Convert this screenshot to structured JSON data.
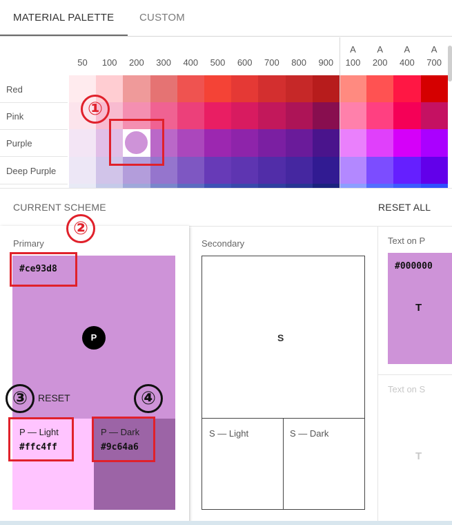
{
  "tabs": [
    {
      "label": "MATERIAL PALETTE",
      "active": true
    },
    {
      "label": "CUSTOM",
      "active": false
    }
  ],
  "palette": {
    "columns": [
      "50",
      "100",
      "200",
      "300",
      "400",
      "500",
      "600",
      "700",
      "800",
      "900"
    ],
    "accent_columns": [
      {
        "prefix": "A",
        "shade": "100"
      },
      {
        "prefix": "A",
        "shade": "200"
      },
      {
        "prefix": "A",
        "shade": "400"
      },
      {
        "prefix": "A",
        "shade": "700"
      }
    ],
    "rows": [
      {
        "name": "Red",
        "colors": [
          "#ffebee",
          "#ffcdd2",
          "#ef9a9a",
          "#e57373",
          "#ef5350",
          "#f44336",
          "#e53935",
          "#d32f2f",
          "#c62828",
          "#b71c1c"
        ],
        "accents": [
          "#ff8a80",
          "#ff5252",
          "#ff1744",
          "#d50000"
        ]
      },
      {
        "name": "Pink",
        "colors": [
          "#fce4ec",
          "#f8bbd0",
          "#f48fb1",
          "#f06292",
          "#ec407a",
          "#e91e63",
          "#d81b60",
          "#c2185b",
          "#ad1457",
          "#880e4f"
        ],
        "accents": [
          "#ff80ab",
          "#ff4081",
          "#f50057",
          "#c51162"
        ]
      },
      {
        "name": "Purple",
        "colors": [
          "#f3e5f5",
          "#e1bee7",
          "#ce93d8",
          "#ba68c8",
          "#ab47bc",
          "#9c27b0",
          "#8e24aa",
          "#7b1fa2",
          "#6a1b9a",
          "#4a148c"
        ],
        "accents": [
          "#ea80fc",
          "#e040fb",
          "#d500f9",
          "#aa00ff"
        ]
      },
      {
        "name": "Deep Purple",
        "colors": [
          "#ede7f6",
          "#d1c4e9",
          "#b39ddb",
          "#9575cd",
          "#7e57c2",
          "#673ab7",
          "#5e35b1",
          "#512da8",
          "#4527a0",
          "#311b92"
        ],
        "accents": [
          "#b388ff",
          "#7c4dff",
          "#651fff",
          "#6200ea"
        ]
      },
      {
        "name": "",
        "colors": [
          "#e8eaf6",
          "#c5cae9",
          "#9fa8da",
          "#7986cb",
          "#5c6bc0",
          "#3f51b5",
          "#3949ab",
          "#303f9f",
          "#283593",
          "#1a237e"
        ],
        "accents": [
          "#8c9eff",
          "#536dfe",
          "#3d5afe",
          "#304ffe"
        ]
      }
    ],
    "selected": {
      "row": "Purple",
      "shade": "200",
      "color": "#ce93d8"
    }
  },
  "scheme": {
    "title": "CURRENT SCHEME",
    "reset_all": "RESET ALL",
    "primary": {
      "label": "Primary",
      "hex": "#ce93d8",
      "color": "#ce93d8",
      "badge": "P",
      "reset": "RESET",
      "light": {
        "label": "P — Light",
        "hex": "#ffc4ff",
        "color": "#ffc4ff"
      },
      "dark": {
        "label": "P — Dark",
        "hex": "#9c64a6",
        "color": "#9c64a6"
      }
    },
    "secondary": {
      "label": "Secondary",
      "letter": "S",
      "light": {
        "label": "S — Light"
      },
      "dark": {
        "label": "S — Dark"
      }
    },
    "text_on_p": {
      "label": "Text on P",
      "hex": "#000000",
      "letter": "T",
      "bg": "#ce93d8"
    },
    "text_on_s": {
      "label": "Text on S",
      "letter": "T"
    }
  },
  "annotations": [
    "①",
    "②",
    "③",
    "④"
  ],
  "colors": {
    "annotation": "#e0212b"
  }
}
